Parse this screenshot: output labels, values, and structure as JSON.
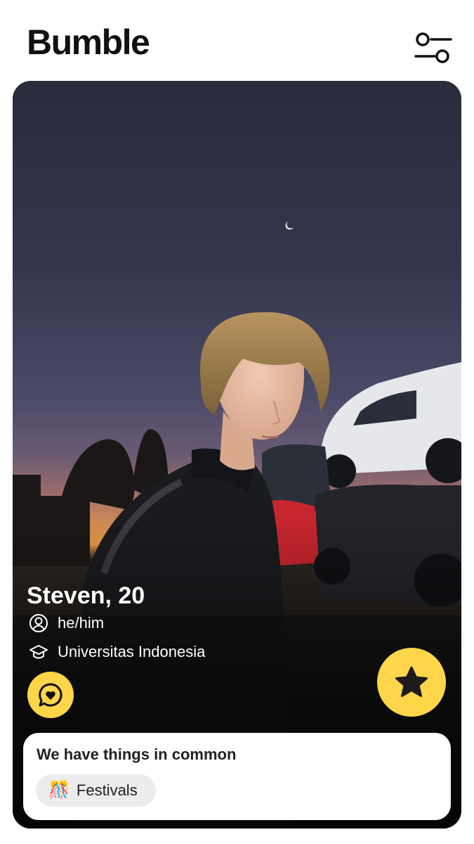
{
  "app": {
    "brand": "Bumble",
    "filter_icon": "filter-sliders-icon"
  },
  "profile": {
    "name_age": "Steven, 20",
    "pronouns": "he/him",
    "pronouns_icon": "person-circle-icon",
    "school": "Universitas Indonesia",
    "school_icon": "graduation-cap-icon",
    "photo_description_icon": "profile-photo"
  },
  "actions": {
    "chat_icon": "chat-heart-icon",
    "superswipe_icon": "star-icon"
  },
  "common": {
    "title": "We have things in common",
    "chips": [
      {
        "icon": "🎊",
        "label": "Festivals"
      }
    ]
  },
  "colors": {
    "accent": "#ffd64a",
    "text_dark": "#111111",
    "chip_bg": "#ececec"
  }
}
